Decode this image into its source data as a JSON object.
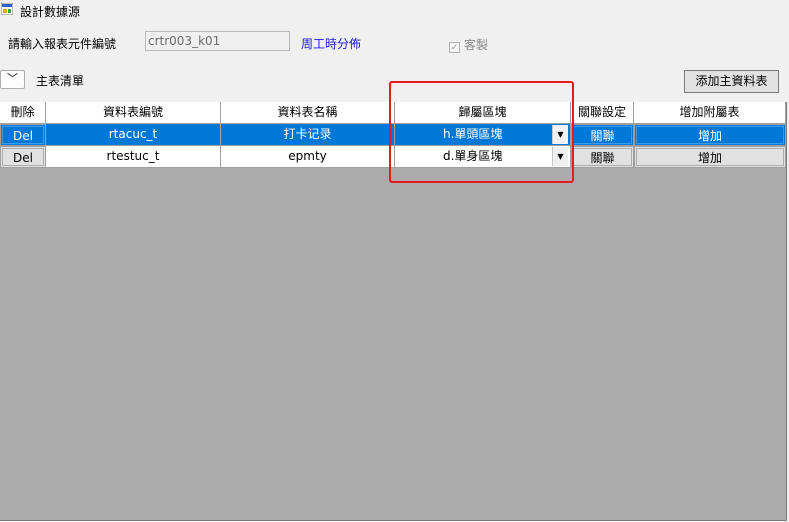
{
  "window": {
    "title": "設計數據源",
    "icon": "form-app-icon"
  },
  "form": {
    "input_label": "請輸入報表元件編號",
    "input_value": "crtr003_k01",
    "link_text": "周工時分佈",
    "checkbox_label": "客製",
    "checkbox_checked": true
  },
  "section": {
    "collapse_icon": "chevron-down-icon",
    "label": "主表清單",
    "add_main_button": "添加主資料表"
  },
  "grid": {
    "headers": [
      "刪除",
      "資料表編號",
      "資料表名稱",
      "歸屬區塊",
      "關聯設定",
      "增加附屬表"
    ],
    "rows": [
      {
        "delete": "Del",
        "table_id": "rtacuc_t",
        "table_name": "打卡记录",
        "block": "h.單頭區塊",
        "relation": "關聯",
        "add_sub": "增加",
        "selected": true
      },
      {
        "delete": "Del",
        "table_id": "rtestuc_t",
        "table_name": "epmty",
        "block": "d.單身區塊",
        "relation": "關聯",
        "add_sub": "增加",
        "selected": false
      }
    ]
  },
  "colors": {
    "selection": "#0078d7",
    "highlight": "#e8191c",
    "link": "#1a1ad2",
    "grid_background": "#ababab"
  }
}
